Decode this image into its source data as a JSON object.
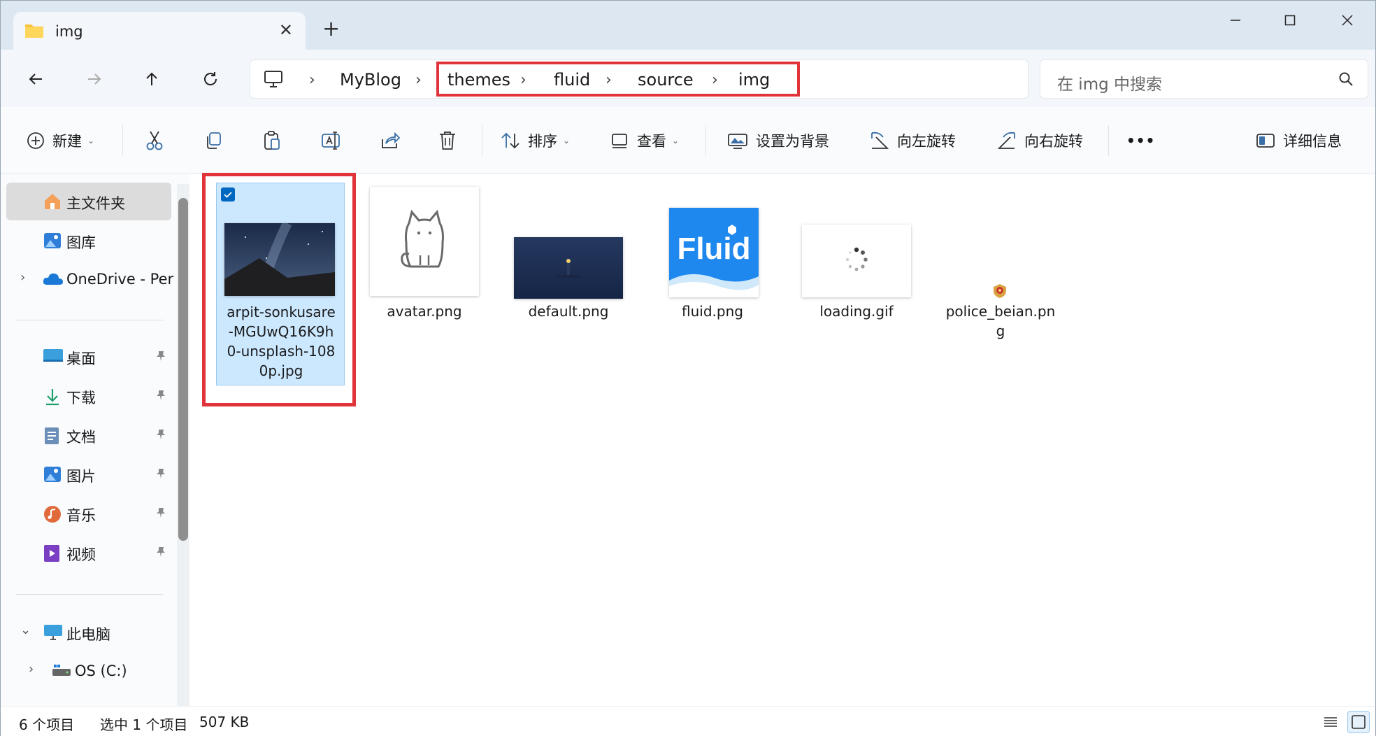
{
  "window": {
    "tab_title": "img",
    "new_tab": "+",
    "controls": {
      "minimize": "—",
      "maximize": "☐",
      "close": "✕"
    }
  },
  "nav": {
    "breadcrumbs": [
      "MyBlog",
      "themes",
      "fluid",
      "source",
      "img"
    ],
    "search_placeholder": "在 img 中搜索"
  },
  "toolbar": {
    "new_label": "新建",
    "sort_label": "排序",
    "view_label": "查看",
    "set_background": "设置为背景",
    "rotate_left": "向左旋转",
    "rotate_right": "向右旋转",
    "more": "•••",
    "details": "详细信息"
  },
  "sidebar": {
    "items": [
      {
        "label": "主文件夹",
        "icon": "home-icon"
      },
      {
        "label": "图库",
        "icon": "gallery-icon"
      },
      {
        "label": "OneDrive - Per",
        "icon": "onedrive-icon"
      },
      {
        "label": "桌面",
        "icon": "desktop-icon"
      },
      {
        "label": "下载",
        "icon": "download-icon"
      },
      {
        "label": "文档",
        "icon": "documents-icon"
      },
      {
        "label": "图片",
        "icon": "pictures-icon"
      },
      {
        "label": "音乐",
        "icon": "music-icon"
      },
      {
        "label": "视频",
        "icon": "videos-icon"
      },
      {
        "label": "此电脑",
        "icon": "pc-icon"
      },
      {
        "label": "OS (C:)",
        "icon": "drive-icon"
      }
    ]
  },
  "files": [
    {
      "name": "arpit-sonkusare-MGUwQ16K9h0-unsplash-1080p.jpg",
      "lines": [
        "arpit-sonkusare",
        "-MGUwQ16K9h",
        "0-unsplash-108",
        "0p.jpg"
      ]
    },
    {
      "name": "avatar.png"
    },
    {
      "name": "default.png"
    },
    {
      "name": "fluid.png",
      "logo_text": "Fluid"
    },
    {
      "name": "loading.gif"
    },
    {
      "name": "police_beian.png",
      "lines": [
        "police_beian.pn",
        "g"
      ]
    }
  ],
  "status": {
    "count": "6 个项目",
    "selection": "选中 1 个项目",
    "size": "507 KB"
  },
  "colors": {
    "accent": "#0067c0",
    "highlight_box": "#e0333a",
    "selection": "#cce8ff"
  }
}
